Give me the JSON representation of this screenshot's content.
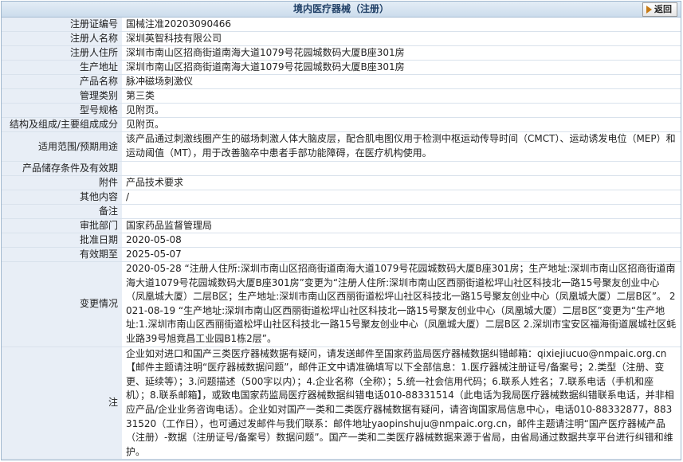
{
  "header": {
    "title": "境内医疗器械（注册）",
    "back_label": "返回"
  },
  "rows": [
    {
      "label": "注册证编号",
      "value": "国械注准20203090466"
    },
    {
      "label": "注册人名称",
      "value": "深圳英智科技有限公司"
    },
    {
      "label": "注册人住所",
      "value": "深圳市南山区招商街道南海大道1079号花园城数码大厦B座301房"
    },
    {
      "label": "生产地址",
      "value": "深圳市南山区招商街道南海大道1079号花园城数码大厦B座301房"
    },
    {
      "label": "产品名称",
      "value": "脉冲磁场刺激仪"
    },
    {
      "label": "管理类别",
      "value": "第三类"
    },
    {
      "label": "型号规格",
      "value": "见附页。"
    },
    {
      "label": "结构及组成/主要组成成分",
      "value": "见附页。"
    },
    {
      "label": "适用范围/预期用途",
      "value": "该产品通过刺激线圈产生的磁场刺激人体大脑皮层，配合肌电图仪用于检测中枢运动传导时间（CMCT）、运动诱发电位（MEP）和运动阈值（MT），用于改善脑卒中患者手部功能障碍，在医疗机构使用。"
    },
    {
      "label": "产品储存条件及有效期",
      "value": ""
    },
    {
      "label": "附件",
      "value": "产品技术要求"
    },
    {
      "label": "其他内容",
      "value": "/"
    },
    {
      "label": "备注",
      "value": ""
    },
    {
      "label": "审批部门",
      "value": "国家药品监督管理局"
    },
    {
      "label": "批准日期",
      "value": "2020-05-08"
    },
    {
      "label": "有效期至",
      "value": "2025-05-07"
    },
    {
      "label": "变更情况",
      "value": "2020-05-28 “注册人住所:深圳市南山区招商街道南海大道1079号花园城数码大厦B座301房；生产地址:深圳市南山区招商街道南海大道1079号花园城数码大厦B座301房”变更为“注册人住所:深圳市南山区西丽街道松坪山社区科技北一路15号聚友创业中心（凤凰城大厦）二层B区；生产地址:深圳市南山区西丽街道松坪山社区科技北一路15号聚友创业中心（凤凰城大厦）二层B区”。 2021-08-19 “生产地址:深圳市南山区西丽街道松坪山社区科技北一路15号聚友创业中心（凤凰城大厦）二层B区”变更为“生产地址:1.深圳市南山区西丽街道松坪山社区科技北一路15号聚友创业中心（凤凰城大厦）二层B区 2.深圳市宝安区福海街道展城社区蚝业路39号旭竟昌工业园B1栋2层”。"
    },
    {
      "label": "注",
      "value": "企业如对进口和国产三类医疗器械数据有疑问，请发送邮件至国家药监局医疗器械数据纠错邮箱：qixiejiucuo@nmpaic.org.cn【邮件主题请注明“医疗器械数据问题”，邮件正文中请准确填写以下全部信息：1.医疗器械注册证号/备案号；2.类型（注册、变更、延续等）；3.问题描述（500字以内）；4.企业名称（全称）；5.统一社会信用代码；6.联系人姓名；7.联系电话（手机和座机）；8.联系邮箱】，或致电国家药监局医疗器械数据纠错电话010-88331514（此电话为我局医疗器械数据纠错联系电话，并非相应产品/企业业务咨询电话）。企业如对国产一类和二类医疗器械数据有疑问，请咨询国家局信息中心，电话010-88332877，88331520（工作日），也可通过发邮件与我们联系：邮件地址yaopinshuju@nmpaic.org.cn，邮件主题请注明“国产医疗器械产品（注册）-数据（注册证号/备案号）数据问题”。国产一类和二类医疗器械数据来源于省局，由省局通过数据共享平台进行纠错和维护。"
    }
  ]
}
